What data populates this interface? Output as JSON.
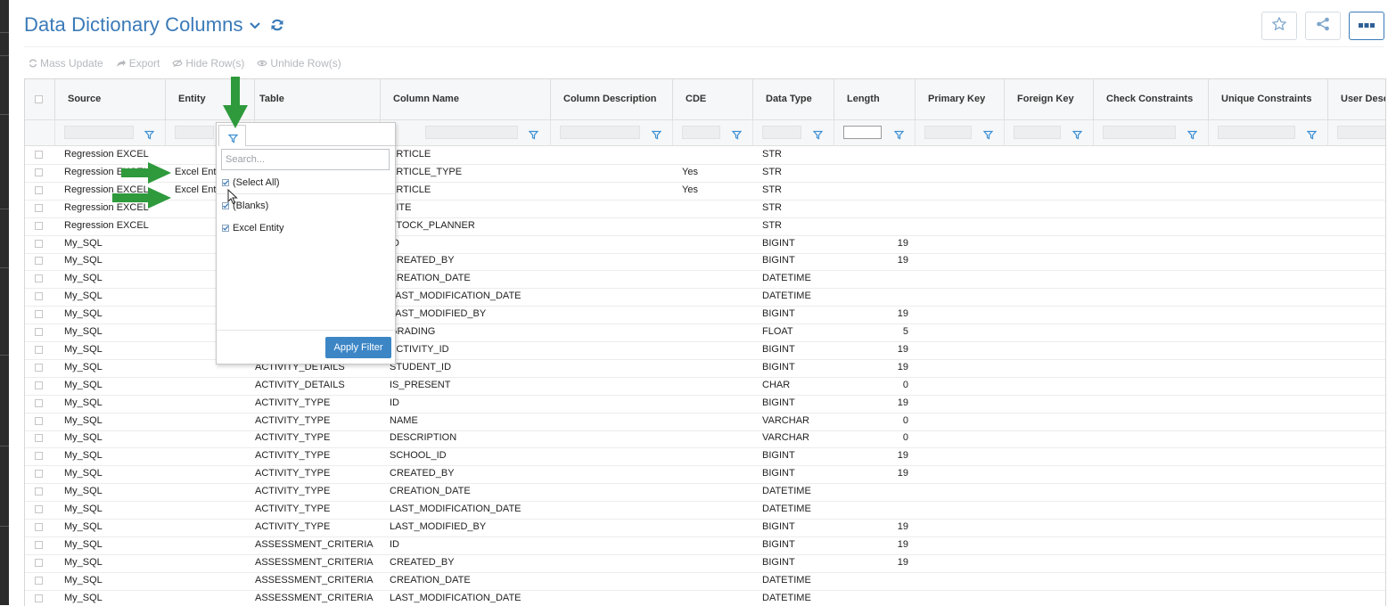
{
  "header": {
    "title": "Data Dictionary Columns",
    "title_icon": "chevron-down-icon",
    "refresh_icon": "refresh-icon",
    "actions": [
      {
        "name": "favorite-button",
        "icon": "star-icon"
      },
      {
        "name": "share-button",
        "icon": "share-icon"
      },
      {
        "name": "more-options-button",
        "icon": "ellipsis-icon"
      }
    ]
  },
  "toolbar": {
    "mass_update": "Mass Update",
    "export": "Export",
    "hide_rows": "Hide Row(s)",
    "unhide_rows": "Unhide Row(s)"
  },
  "grid": {
    "columns": [
      "Source",
      "Entity",
      "Table",
      "Column Name",
      "Column Description",
      "CDE",
      "Data Type",
      "Length",
      "Primary Key",
      "Foreign Key",
      "Check Constraints",
      "Unique Constraints",
      "User Descr"
    ],
    "rows": [
      {
        "source": "Regression EXCEL",
        "entity": "",
        "table": "",
        "column": "ARTICLE",
        "cde": "",
        "type": "STR",
        "length": ""
      },
      {
        "source": "Regression EXCEL",
        "entity": "Excel Entit",
        "table": "",
        "column": "ARTICLE_TYPE",
        "cde": "Yes",
        "type": "STR",
        "length": ""
      },
      {
        "source": "Regression EXCEL",
        "entity": "Excel Entit",
        "table": "",
        "column": "ARTICLE",
        "cde": "Yes",
        "type": "STR",
        "length": ""
      },
      {
        "source": "Regression EXCEL",
        "entity": "",
        "table": "",
        "column": "SITE",
        "cde": "",
        "type": "STR",
        "length": ""
      },
      {
        "source": "Regression EXCEL",
        "entity": "",
        "table": "",
        "column": "STOCK_PLANNER",
        "cde": "",
        "type": "STR",
        "length": ""
      },
      {
        "source": "My_SQL",
        "entity": "",
        "table": "",
        "column": "ID",
        "cde": "",
        "type": "BIGINT",
        "length": "19"
      },
      {
        "source": "My_SQL",
        "entity": "",
        "table": "",
        "column": "CREATED_BY",
        "cde": "",
        "type": "BIGINT",
        "length": "19"
      },
      {
        "source": "My_SQL",
        "entity": "",
        "table": "",
        "column": "CREATION_DATE",
        "cde": "",
        "type": "DATETIME",
        "length": ""
      },
      {
        "source": "My_SQL",
        "entity": "",
        "table": "",
        "column": "LAST_MODIFICATION_DATE",
        "cde": "",
        "type": "DATETIME",
        "length": ""
      },
      {
        "source": "My_SQL",
        "entity": "",
        "table": "",
        "column": "LAST_MODIFIED_BY",
        "cde": "",
        "type": "BIGINT",
        "length": "19"
      },
      {
        "source": "My_SQL",
        "entity": "",
        "table": "",
        "column": "GRADING",
        "cde": "",
        "type": "FLOAT",
        "length": "5"
      },
      {
        "source": "My_SQL",
        "entity": "",
        "table": "",
        "column": "ACTIVITY_ID",
        "cde": "",
        "type": "BIGINT",
        "length": "19"
      },
      {
        "source": "My_SQL",
        "entity": "",
        "table": "ACTIVITY_DETAILS",
        "column": "STUDENT_ID",
        "cde": "",
        "type": "BIGINT",
        "length": "19"
      },
      {
        "source": "My_SQL",
        "entity": "",
        "table": "ACTIVITY_DETAILS",
        "column": "IS_PRESENT",
        "cde": "",
        "type": "CHAR",
        "length": "0"
      },
      {
        "source": "My_SQL",
        "entity": "",
        "table": "ACTIVITY_TYPE",
        "column": "ID",
        "cde": "",
        "type": "BIGINT",
        "length": "19"
      },
      {
        "source": "My_SQL",
        "entity": "",
        "table": "ACTIVITY_TYPE",
        "column": "NAME",
        "cde": "",
        "type": "VARCHAR",
        "length": "0"
      },
      {
        "source": "My_SQL",
        "entity": "",
        "table": "ACTIVITY_TYPE",
        "column": "DESCRIPTION",
        "cde": "",
        "type": "VARCHAR",
        "length": "0"
      },
      {
        "source": "My_SQL",
        "entity": "",
        "table": "ACTIVITY_TYPE",
        "column": "SCHOOL_ID",
        "cde": "",
        "type": "BIGINT",
        "length": "19"
      },
      {
        "source": "My_SQL",
        "entity": "",
        "table": "ACTIVITY_TYPE",
        "column": "CREATED_BY",
        "cde": "",
        "type": "BIGINT",
        "length": "19"
      },
      {
        "source": "My_SQL",
        "entity": "",
        "table": "ACTIVITY_TYPE",
        "column": "CREATION_DATE",
        "cde": "",
        "type": "DATETIME",
        "length": ""
      },
      {
        "source": "My_SQL",
        "entity": "",
        "table": "ACTIVITY_TYPE",
        "column": "LAST_MODIFICATION_DATE",
        "cde": "",
        "type": "DATETIME",
        "length": ""
      },
      {
        "source": "My_SQL",
        "entity": "",
        "table": "ACTIVITY_TYPE",
        "column": "LAST_MODIFIED_BY",
        "cde": "",
        "type": "BIGINT",
        "length": "19"
      },
      {
        "source": "My_SQL",
        "entity": "",
        "table": "ASSESSMENT_CRITERIA",
        "column": "ID",
        "cde": "",
        "type": "BIGINT",
        "length": "19"
      },
      {
        "source": "My_SQL",
        "entity": "",
        "table": "ASSESSMENT_CRITERIA",
        "column": "CREATED_BY",
        "cde": "",
        "type": "BIGINT",
        "length": "19"
      },
      {
        "source": "My_SQL",
        "entity": "",
        "table": "ASSESSMENT_CRITERIA",
        "column": "CREATION_DATE",
        "cde": "",
        "type": "DATETIME",
        "length": ""
      },
      {
        "source": "My_SQL",
        "entity": "",
        "table": "ASSESSMENT_CRITERIA",
        "column": "LAST_MODIFICATION_DATE",
        "cde": "",
        "type": "DATETIME",
        "length": ""
      }
    ]
  },
  "filter_popup": {
    "search_placeholder": "Search...",
    "options": [
      {
        "label": "(Select All)",
        "checked": true
      },
      {
        "label": "(Blanks)",
        "checked": true
      },
      {
        "label": "Excel Entity",
        "checked": true
      }
    ],
    "apply_label": "Apply Filter"
  },
  "colors": {
    "accent": "#3a7ab8",
    "apply_button": "#3d86c6",
    "filter_icon": "#3a8fd4",
    "annotation_arrow": "#2e9a3c"
  }
}
